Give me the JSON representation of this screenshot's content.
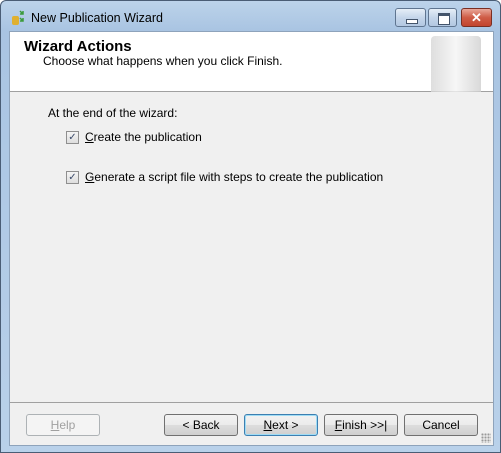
{
  "window": {
    "title": "New Publication Wizard",
    "close_glyph": "✕"
  },
  "header": {
    "title": "Wizard Actions",
    "subtitle": "Choose what happens when you click Finish."
  },
  "body": {
    "prompt": "At the end of the wizard:",
    "options": [
      {
        "label": "Create the publication",
        "checked": true
      },
      {
        "label": "Generate a script file with steps to create the publication",
        "checked": true
      }
    ]
  },
  "buttons": {
    "help": "Help",
    "back": "< Back",
    "next": "Next >",
    "finish": "Finish >>|",
    "cancel": "Cancel"
  },
  "check_glyph": "✓"
}
